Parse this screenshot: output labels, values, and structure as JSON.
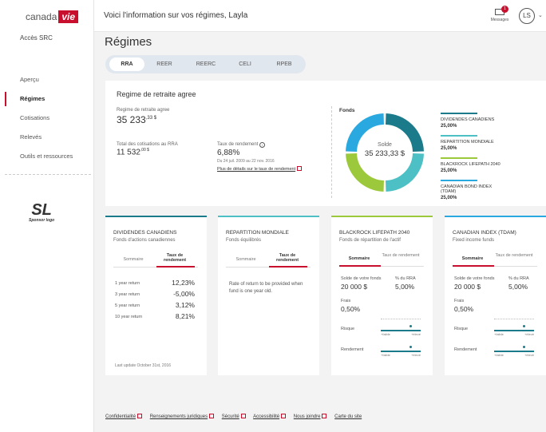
{
  "sidebar": {
    "logo_text": "canada",
    "logo_badge": "vie",
    "acces": "Accès SRC",
    "nav": [
      "Aperçu",
      "Régimes",
      "Cotisations",
      "Relevés",
      "Outils et ressources"
    ],
    "sponsor_big": "SL",
    "sponsor_small": "Sponsor logo"
  },
  "topbar": {
    "greeting": "Voici l'information sur vos régimes, Layla",
    "messages_label": "Messages",
    "messages_count": "1",
    "avatar": "LS"
  },
  "page": {
    "title": "Régimes",
    "tabs": [
      "RRA",
      "REER",
      "REERC",
      "CELI",
      "RPEB"
    ]
  },
  "summary": {
    "title": "Regime de retraite agree",
    "plan_label": "Regime de retraite agree",
    "plan_amount": "35 233",
    "plan_cents": ",33 $",
    "contrib_label": "Total des cotisations au RRA",
    "contrib_amount": "11 532",
    "contrib_cents": ",00 $",
    "rate_label": "Taux de rendement",
    "rate_value": "6,88%",
    "rate_period": "Du 24 juil. 2009 au 22 nov. 2016",
    "rate_link": "Plus de détails sur le taux de rendement",
    "fonds_label": "Fonds",
    "donut_label": "Solde",
    "donut_value": "35 233,33 $",
    "funds": [
      {
        "name": "DIVIDENDES CANADIENS",
        "pct": "25,00%",
        "share": 25,
        "color": "#1c7b8a"
      },
      {
        "name": "REPARTITION MONDIALE",
        "pct": "25,00%",
        "share": 25,
        "color": "#4cc0c5"
      },
      {
        "name": "BLACKROCK LIFEPATH 2040",
        "pct": "25,00%",
        "share": 25,
        "color": "#9cc93b"
      },
      {
        "name": "CANADIAN BOND INDEX (TDAM)",
        "pct": "25,00%",
        "share": 25,
        "color": "#2aa9e0"
      }
    ]
  },
  "cards": [
    {
      "title": "DIVIDENDES CANADIENS",
      "subtitle": "Fonds d'actions canadiennes",
      "tab1": "Sommaire",
      "tab2": "Taux de rendement",
      "returns": [
        {
          "label": "1 year return",
          "value": "12,23%"
        },
        {
          "label": "3 year return",
          "value": "-5,00%"
        },
        {
          "label": "5 year return",
          "value": "3,12%"
        },
        {
          "label": "10 year return",
          "value": "8,21%"
        }
      ],
      "last_update": "Last update October 31st, 2016"
    },
    {
      "title": "REPARTITION MONDIALE",
      "subtitle": "Fonds équilibrés",
      "tab1": "Sommaire",
      "tab2": "Taux de rendement",
      "message": "Rate of return to be provided when fund is one year old."
    },
    {
      "title": "BLACKROCK LIFEPATH 2040",
      "subtitle": "Fonds de répartition de l'actif",
      "tab1": "Sommaire",
      "tab2": "Taux de rendement",
      "balance_label": "Solde de votre fonds",
      "share_label": "% du RRA",
      "balance": "20 000 $",
      "share": "5,00%",
      "fees_label": "Frais",
      "fees": "0,50%",
      "risk_label": "Risque",
      "return_label": "Rendement",
      "low": "+faible",
      "high": "+élevé"
    },
    {
      "title": "CANADIAN INDEX (TDAM)",
      "subtitle": "Fixed income funds",
      "tab1": "Sommaire",
      "tab2": "Taux de rendement",
      "balance_label": "Solde de votre fonds",
      "share_label": "% du RRA",
      "balance": "20 000 $",
      "share": "5,00%",
      "fees_label": "Frais",
      "fees": "0,50%",
      "risk_label": "Risque",
      "return_label": "Rendement",
      "low": "+faible",
      "high": "+élevé"
    }
  ],
  "footer": [
    "Confidentialité",
    "Renseignements juridiques",
    "Sécurité",
    "Accessibilité",
    "Nous joindre",
    "Carte du site"
  ],
  "colors": {
    "brand": "#c8102e",
    "teal": "#1c7b8a",
    "aqua": "#4cc0c5",
    "lime": "#9cc93b",
    "blue": "#2aa9e0"
  }
}
